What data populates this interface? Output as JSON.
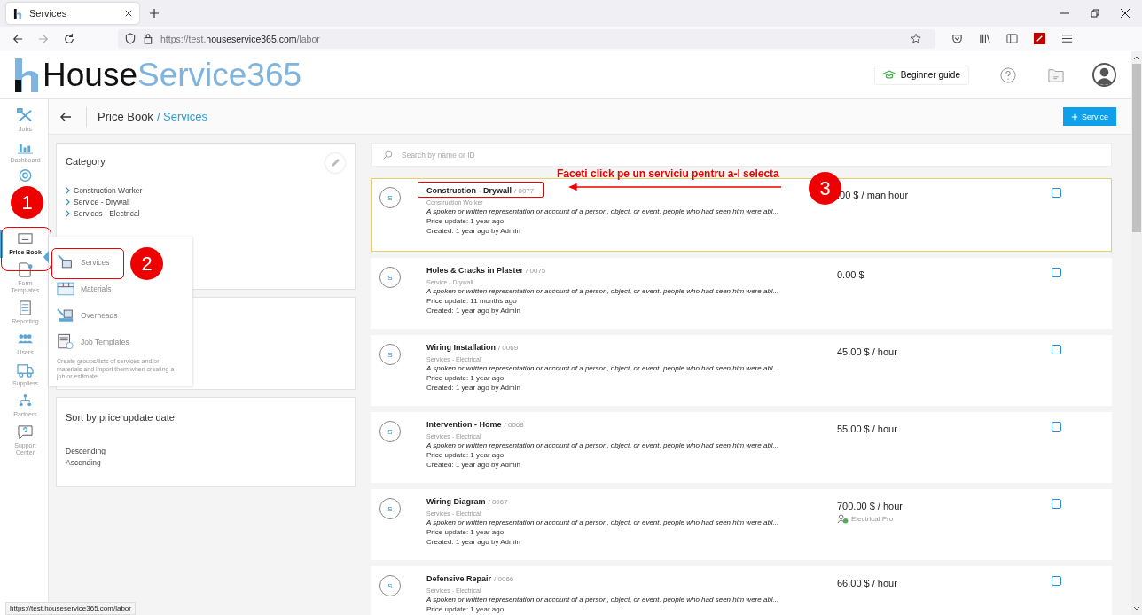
{
  "browser": {
    "tab_title": "Services",
    "url_prefix": "https://test.",
    "url_domain": "houseservice365.com",
    "url_path": "/labor",
    "status_url": "https://test.houseservice365.com/labor"
  },
  "header": {
    "logo_dark": "House",
    "logo_light": "Service365",
    "guide_button": "Beginner guide"
  },
  "nav": [
    {
      "label": "Jobs",
      "selected": false
    },
    {
      "label": "Dashboard",
      "selected": false
    },
    {
      "selected": false
    },
    {
      "label": "Price Book",
      "selected": true
    },
    {
      "label": "Form Templates",
      "selected": false
    },
    {
      "label": "Reporting",
      "selected": false
    },
    {
      "label": "Users",
      "selected": false
    },
    {
      "label": "Suppliers",
      "selected": false
    },
    {
      "label": "Partners",
      "selected": false
    },
    {
      "label": "Support Center",
      "selected": false
    }
  ],
  "breadcrumb": {
    "parent": "Price Book",
    "current": "/ Services"
  },
  "add_button": {
    "label": "Service"
  },
  "category": {
    "title": "Category",
    "items": [
      "Construction Worker",
      "Service - Drywall",
      "Services - Electrical"
    ]
  },
  "sort": {
    "title": "Sort by price update date",
    "options": [
      "Descending",
      "Ascending"
    ]
  },
  "menu": {
    "items": [
      {
        "label": "Services"
      },
      {
        "label": "Materials"
      },
      {
        "label": "Overheads"
      },
      {
        "label": "Job Templates"
      }
    ],
    "note": "Create groups/lists of services and/or materials and import them when creating a job or estimate"
  },
  "search": {
    "placeholder": "Search by name or ID"
  },
  "services": [
    {
      "avatar": "S",
      "name": "Construction - Drywall",
      "code": "/ 0077",
      "category": "Construction Worker",
      "description": "A spoken or written representation or account of a person, object, or event. people who had seen him were abl...",
      "price_update": "Price update: 1 year ago",
      "created": "Created: 1 year ago by Admin",
      "price": ".00 $ / man hour",
      "highlighted": true,
      "checked": false
    },
    {
      "avatar": "S",
      "name": "Holes & Cracks in Plaster",
      "code": "/ 0075",
      "category": "Service - Drywall",
      "description": "A spoken or written representation or account of a person, object, or event. people who had seen him were abl...",
      "price_update": "Price update: 11 months ago",
      "created": "Created: 1 year ago by Admin",
      "price": "0.00 $",
      "highlighted": false,
      "checked": false
    },
    {
      "avatar": "S",
      "name": "Wiring Installation",
      "code": "/ 0069",
      "category": "Services - Electrical",
      "description": "A spoken or written representation or account of a person, object, or event. people who had seen him were abl...",
      "price_update": "Price update: 1 year ago",
      "created": "Created: 1 year ago by Admin",
      "price": "45.00 $ / hour",
      "highlighted": false,
      "checked": false
    },
    {
      "avatar": "S",
      "name": "Intervention - Home",
      "code": "/ 0068",
      "category": "Services - Electrical",
      "description": "A spoken or written representation or account of a person, object, or event. people who had seen him were abl...",
      "price_update": "Price update: 1 year ago",
      "created": "Created: 1 year ago by Admin",
      "price": "55.00 $ / hour",
      "highlighted": false,
      "checked": false
    },
    {
      "avatar": "S",
      "name": "Wiring Diagram",
      "code": "/ 0067",
      "category": "Services - Electrical",
      "description": "A spoken or written representation or account of a person, object, or event. people who had seen him were abl...",
      "price_update": "Price update: 1 year ago",
      "created": "Created: 1 year ago by Admin",
      "price": "700.00 $ / hour",
      "tag": "Electrical Pro",
      "highlighted": false,
      "checked": false
    },
    {
      "avatar": "S",
      "name": "Defensive Repair",
      "code": "/ 0066",
      "category": "Services - Electrical",
      "description": "A spoken or written representation or account of a person, object, or event. people who had seen him were abl...",
      "price_update": "Price update: 1 year ago",
      "price": "66.00 $ / hour",
      "highlighted": false,
      "checked": false
    }
  ],
  "annotations": [
    {
      "number": "1"
    },
    {
      "number": "2"
    },
    {
      "number": "3",
      "text": "Faceti click pe un serviciu pentru a-l selecta"
    }
  ]
}
